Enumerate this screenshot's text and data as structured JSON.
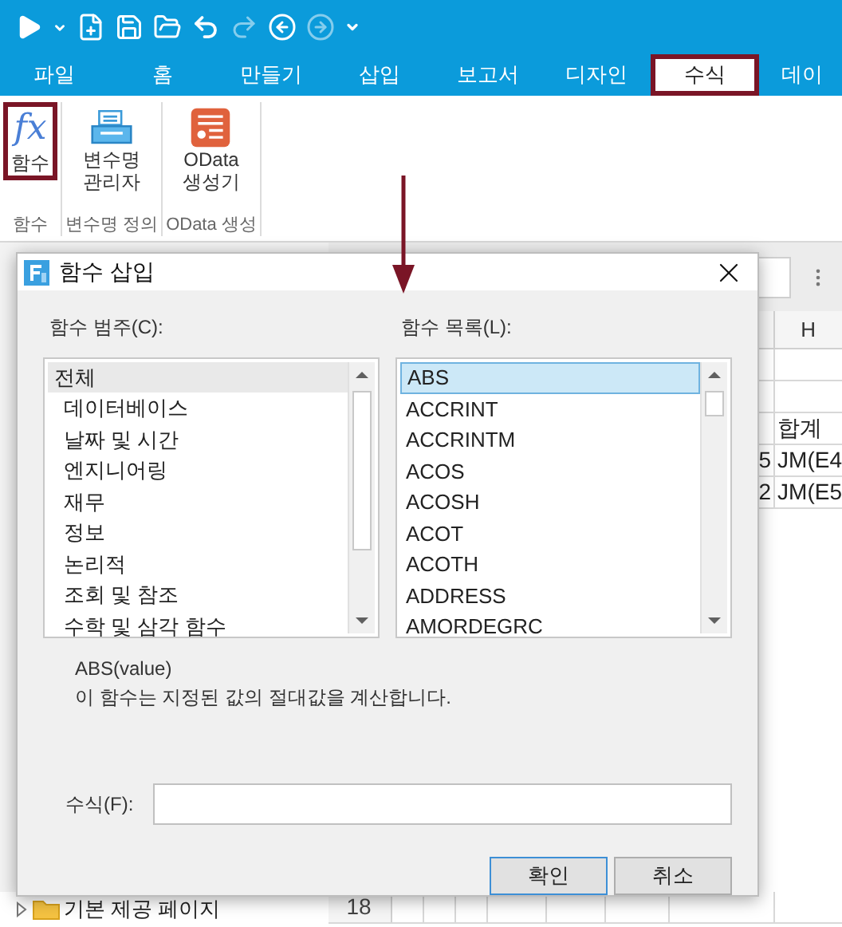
{
  "ribbon_tabs": [
    {
      "label": "파일",
      "selected": false,
      "highlighted": false
    },
    {
      "label": "홈",
      "selected": false,
      "highlighted": false
    },
    {
      "label": "만들기",
      "selected": false,
      "highlighted": false
    },
    {
      "label": "삽입",
      "selected": false,
      "highlighted": false
    },
    {
      "label": "보고서",
      "selected": false,
      "highlighted": false
    },
    {
      "label": "디자인",
      "selected": false,
      "highlighted": false
    },
    {
      "label": "수식",
      "selected": true,
      "highlighted": true
    },
    {
      "label": "데이",
      "selected": false,
      "highlighted": false
    }
  ],
  "ribbon_groups": [
    {
      "caption": "함수",
      "button": {
        "kind": "function",
        "icon_text": "fx",
        "lines": [
          "함수"
        ],
        "highlighted": true
      }
    },
    {
      "caption": "변수명 정의",
      "button": {
        "kind": "variables",
        "lines": [
          "변수명",
          "관리자"
        ],
        "highlighted": false
      }
    },
    {
      "caption": "OData 생성",
      "button": {
        "kind": "odata",
        "lines": [
          "OData",
          "생성기"
        ],
        "highlighted": false
      }
    }
  ],
  "sheet": {
    "column_header": "H",
    "rows": [
      {
        "number": "",
        "g": "",
        "h": ""
      },
      {
        "number": "",
        "g": "",
        "h": ""
      },
      {
        "number": "",
        "g": "",
        "h": "합계"
      },
      {
        "number": "",
        "g": "5",
        "h": "JM(E4"
      },
      {
        "number": "",
        "g": "2",
        "h": "JM(E5"
      },
      {
        "number": "18",
        "g": "",
        "h": ""
      }
    ]
  },
  "tree": [
    {
      "label": "기본 제공 페이지",
      "expanded": false
    }
  ],
  "dialog": {
    "title": "함수 삽입",
    "category_label": "함수 범주(C):",
    "categories": [
      {
        "label": "전체",
        "selected": true,
        "children": [
          {
            "label": "데이터베이스",
            "selected": false
          },
          {
            "label": "날짜 및 시간",
            "selected": false
          },
          {
            "label": "엔지니어링",
            "selected": false
          },
          {
            "label": "재무",
            "selected": false
          },
          {
            "label": "정보",
            "selected": false
          },
          {
            "label": "논리적",
            "selected": false
          },
          {
            "label": "조회 및 참조",
            "selected": false
          },
          {
            "label": "수학 및 삼각 함수",
            "selected": false
          }
        ]
      }
    ],
    "function_label": "함수 목록(L):",
    "functions": [
      {
        "label": "ABS",
        "selected": true
      },
      {
        "label": "ACCRINT",
        "selected": false
      },
      {
        "label": "ACCRINTM",
        "selected": false
      },
      {
        "label": "ACOS",
        "selected": false
      },
      {
        "label": "ACOSH",
        "selected": false
      },
      {
        "label": "ACOT",
        "selected": false
      },
      {
        "label": "ACOTH",
        "selected": false
      },
      {
        "label": "ADDRESS",
        "selected": false
      },
      {
        "label": "AMORDEGRC",
        "selected": false
      }
    ],
    "signature": "ABS(value)",
    "description": "이 함수는 지정된 값의 절대값을 계산합니다.",
    "formula_label": "수식(F):",
    "buttons": [
      {
        "label": "확인",
        "focused": true
      },
      {
        "label": "취소",
        "focused": false
      }
    ]
  }
}
